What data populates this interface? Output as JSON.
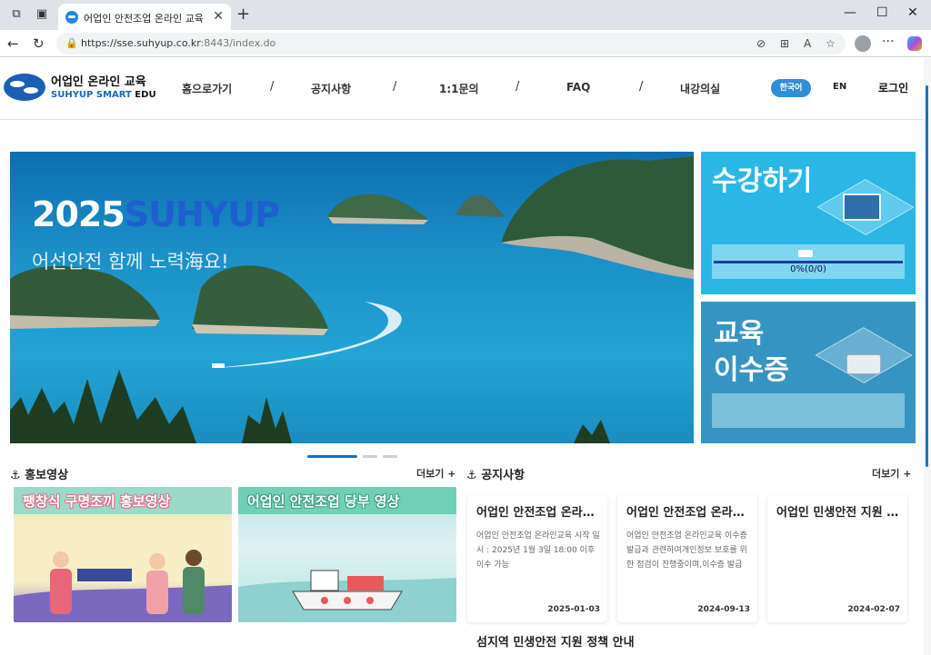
{
  "browser": {
    "tab_title": "어업인 안전조업 온라인 교육",
    "url_host": "https://sse.suhyup.co.kr",
    "url_path": ":8443/index.do"
  },
  "header": {
    "logo_ko": "어업인 온라인 교육",
    "logo_en_brand": "SUHYUP SMART",
    "logo_en_suffix": " EDU",
    "menu": [
      "홈으로가기",
      "공지사항",
      "1:1문의",
      "FAQ",
      "내강의실"
    ],
    "separator": "/",
    "lang_ko": "한국어",
    "lang_en": "EN",
    "login": "로그인"
  },
  "hero": {
    "title_year": "2025",
    "title_brand": "SUHYUP",
    "subtitle": "어선안전 함께 노력海요!"
  },
  "cards": {
    "enroll_title": "수강하기",
    "enroll_progress_text": "0%(0/0)",
    "enroll_progress": 0,
    "cert_title_1": "교육",
    "cert_title_2": "이수증"
  },
  "promo": {
    "heading": "홍보영상",
    "more": "더보기 +",
    "videos": [
      {
        "title": "팽창식 구명조끼 홍보영상"
      },
      {
        "title": "어업인 안전조업 당부 영상"
      }
    ]
  },
  "notice": {
    "heading": "공지사항",
    "more": "더보기 +",
    "items": [
      {
        "title": "어업인 안전조업 온라인교육 시작",
        "body": "어업인 안전조업 온라인교육 시작 일시 : 2025년 1월 3일 18:00 이후 이수 가능",
        "date": "2025-01-03"
      },
      {
        "title": "어업인 안전조업 온라인교육 이수증 발급 안내",
        "body": "어업인 안전조업 온라인교육 이수증 발급과 관련하여개인정보 보호를 위한 점검이 진행중이며,이수증 발급",
        "date": "2024-09-13"
      },
      {
        "title": "어업인 민생안전 지원 안내",
        "body": "",
        "date": "2024-02-07"
      }
    ],
    "extra_title": "섬지역 민생안전 지원 정책 안내"
  },
  "colors": {
    "brand_blue": "#1565c0",
    "lang_badge": "#2d8fd8",
    "enroll_card": "#2bb7e6",
    "cert_card": "#3694c2"
  }
}
